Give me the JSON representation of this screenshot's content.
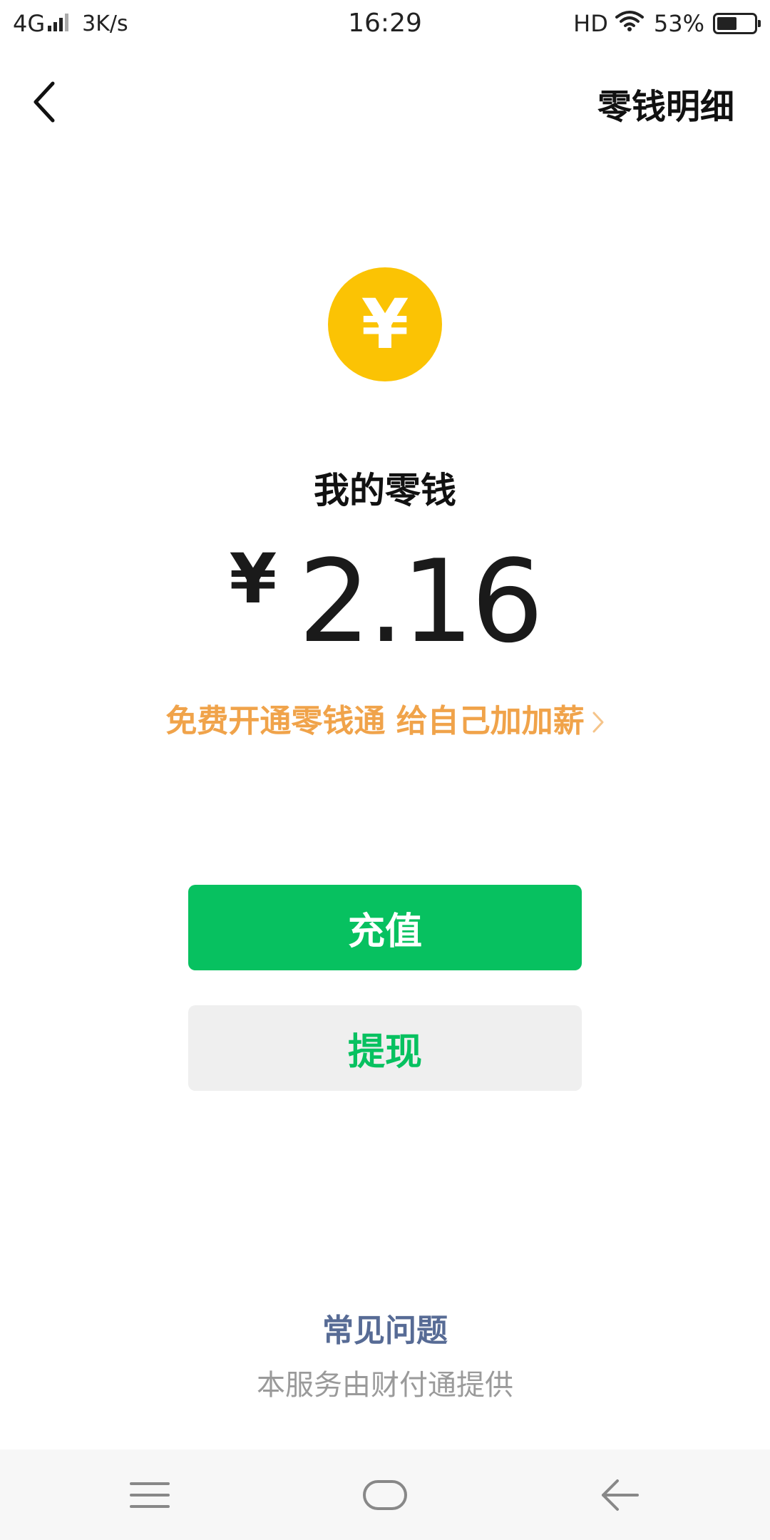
{
  "status_bar": {
    "network": "4G",
    "speed": "3K/s",
    "time": "16:29",
    "hd": "HD",
    "battery_percent": "53%",
    "battery_level": 0.53
  },
  "header": {
    "back_icon": "chevron-left-icon",
    "details_label": "零钱明细"
  },
  "balance": {
    "coin_symbol": "¥",
    "coin_color": "#fbc304",
    "title": "我的零钱",
    "currency": "¥",
    "amount": "2.16"
  },
  "promo": {
    "text": "免费开通零钱通 给自己加加薪",
    "color": "#f0a34a",
    "icon": "chevron-right-icon"
  },
  "actions": {
    "topup_label": "充值",
    "withdraw_label": "提现",
    "accent_color": "#07c160"
  },
  "footer": {
    "faq_label": "常见问题",
    "provider_note": "本服务由财付通提供"
  },
  "nav_bar": {
    "menu_icon": "menu-icon",
    "home_icon": "home-icon",
    "back_icon": "back-arrow-icon"
  }
}
